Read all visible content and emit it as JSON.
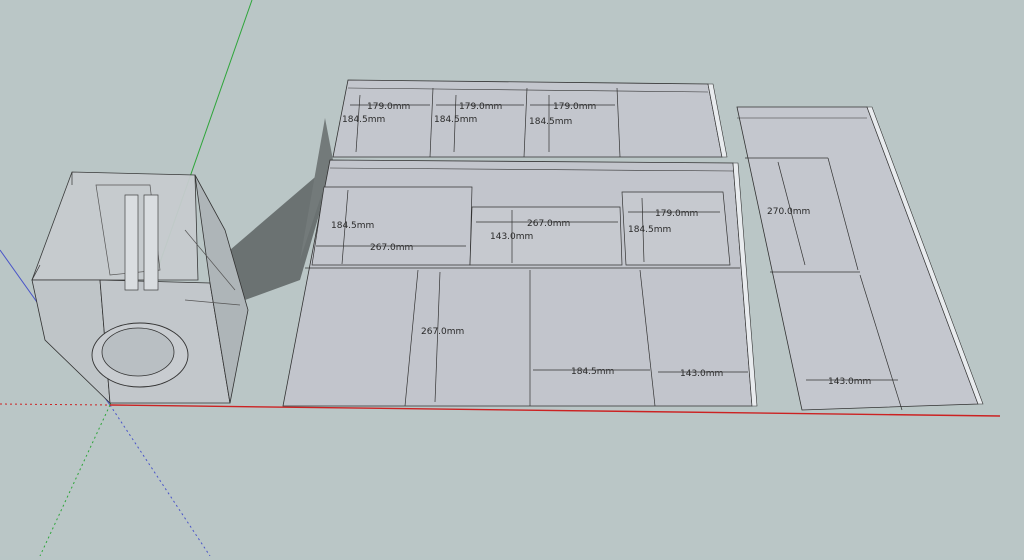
{
  "scene": {
    "colors": {
      "sky": "#bac6c6",
      "panel": "#c3c6cd",
      "panel_edge": "#e9ecf0",
      "shadow": "#6e7575",
      "axis_red": "#cc2222",
      "axis_green": "#2ea53a",
      "axis_blue": "#4a55c8"
    },
    "dims": {
      "top_1": "179.0mm",
      "top_2": "179.0mm",
      "top_3": "179.0mm",
      "top_v1": "184.5mm",
      "top_v2": "184.5mm",
      "top_v3": "184.5mm",
      "mid_v": "184.5mm",
      "mid_267_left": "267.0mm",
      "mid_143": "143.0mm",
      "mid_267_center": "267.0mm",
      "mid_179": "179.0mm",
      "mid_184_right": "184.5mm",
      "low_267": "267.0mm",
      "low_184": "184.5mm",
      "low_143": "143.0mm",
      "right_270": "270.0mm",
      "right_143": "143.0mm"
    }
  }
}
